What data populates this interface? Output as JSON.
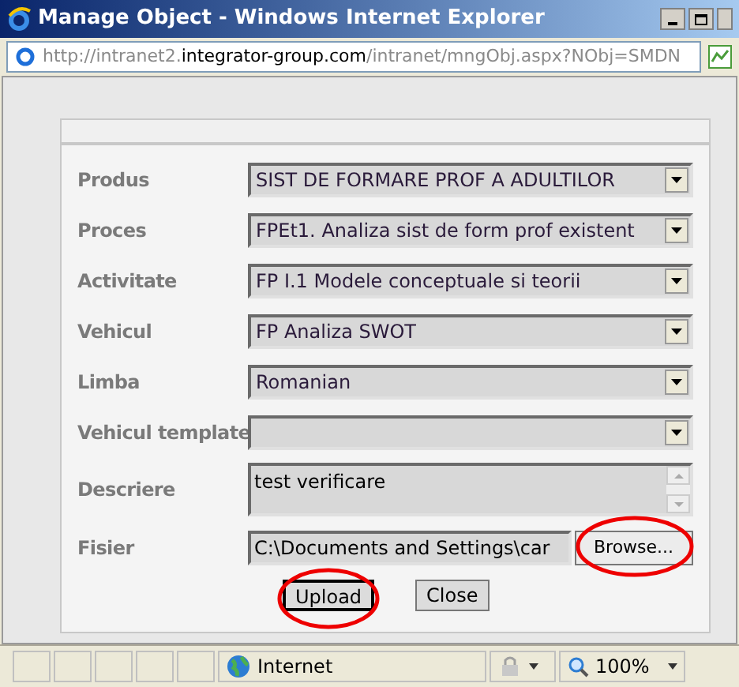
{
  "window": {
    "title": "Manage Object - Windows Internet Explorer"
  },
  "address": {
    "prefix": "http://intranet2.",
    "domain": "integrator-group.com",
    "path": "/intranet/mngObj.aspx?NObj=SMDN"
  },
  "form": {
    "rows": [
      {
        "kind": "select",
        "label": "Produs",
        "value": "SIST DE FORMARE PROF A ADULTILOR"
      },
      {
        "kind": "select",
        "label": "Proces",
        "value": "FPEt1. Analiza sist de form prof existent"
      },
      {
        "kind": "select",
        "label": "Activitate",
        "value": "FP I.1 Modele conceptuale si teorii"
      },
      {
        "kind": "select",
        "label": "Vehicul",
        "value": "FP Analiza SWOT"
      },
      {
        "kind": "select",
        "label": "Limba",
        "value": "Romanian"
      },
      {
        "kind": "select",
        "label": "Vehicul template",
        "value": ""
      },
      {
        "kind": "textarea",
        "label": "Descriere",
        "value": "test verificare"
      },
      {
        "kind": "file",
        "label": "Fisier",
        "value": "C:\\Documents and Settings\\car",
        "button": "Browse..."
      }
    ],
    "buttons": [
      {
        "label": "Upload",
        "selected": true
      },
      {
        "label": "Close",
        "selected": false
      }
    ]
  },
  "status_bar": {
    "zone": "Internet",
    "zoom": "100%"
  }
}
